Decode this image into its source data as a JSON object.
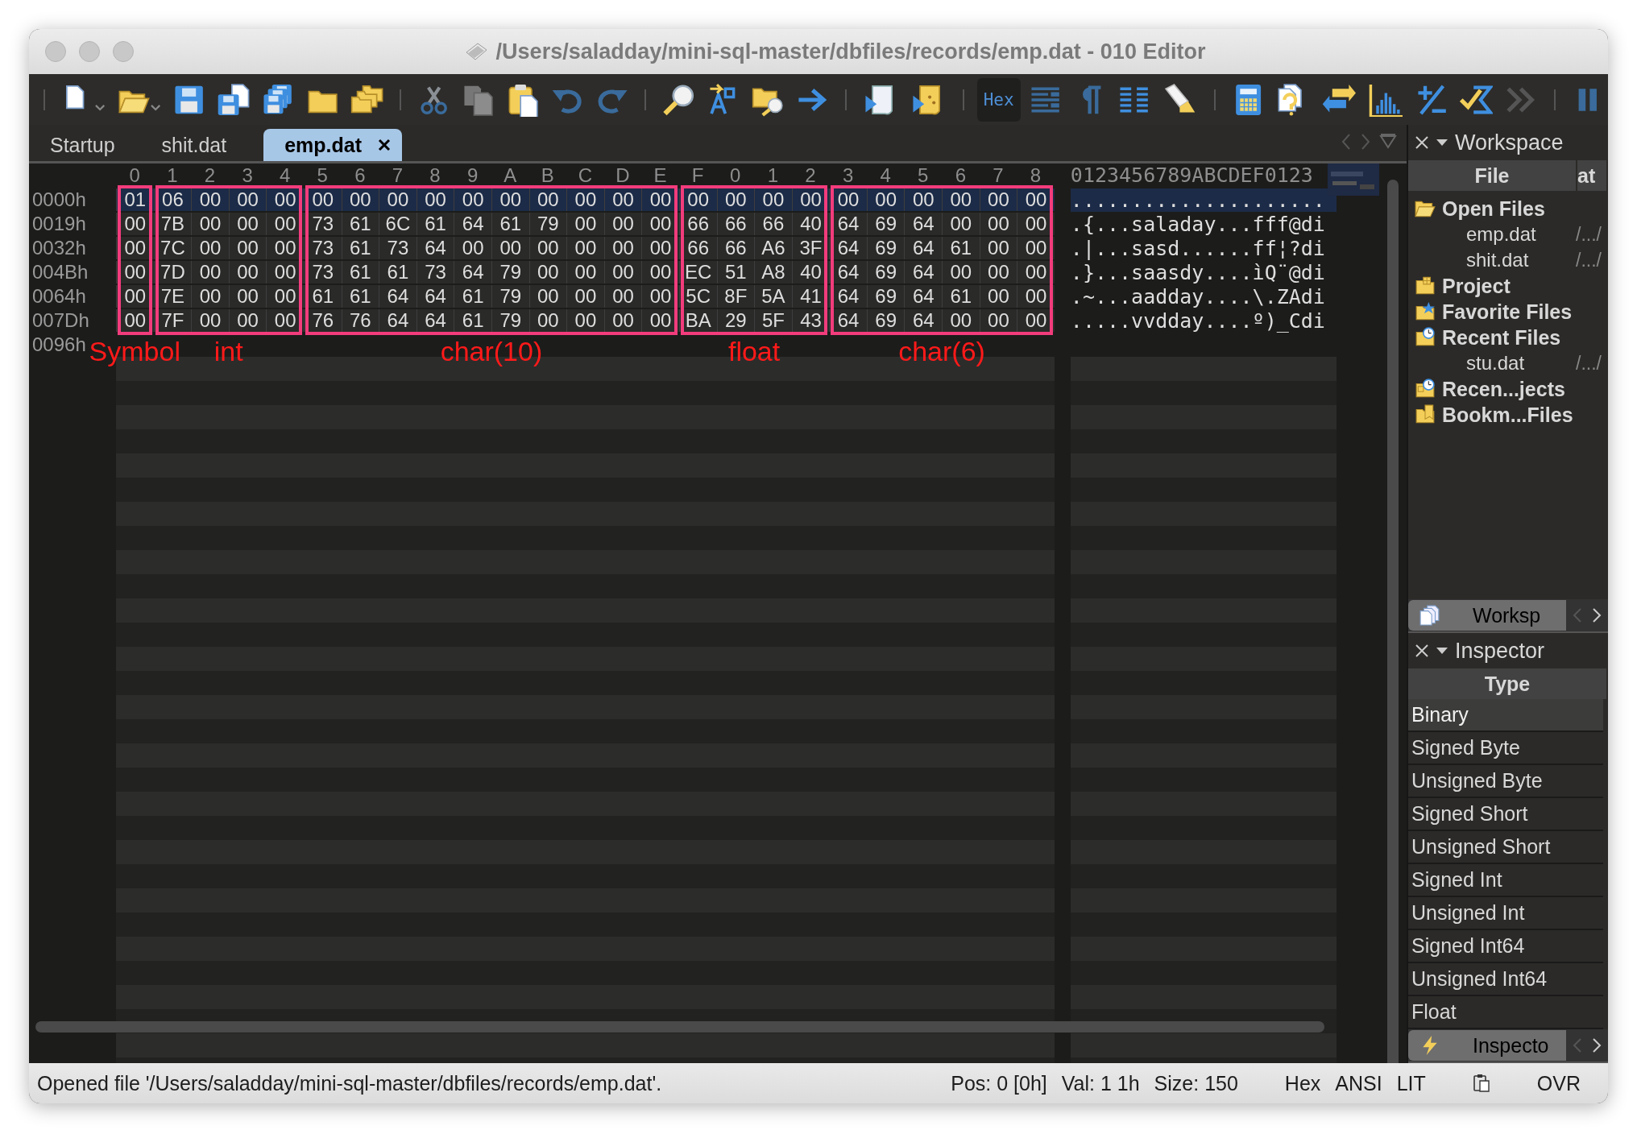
{
  "window": {
    "title": "/Users/saladday/mini-sql-master/dbfiles/records/emp.dat - 010 Editor"
  },
  "toolbar": {
    "hex_button": {
      "label": "Hex",
      "selected": true
    }
  },
  "tabs": [
    {
      "label": "Startup",
      "selected": false,
      "closable": false
    },
    {
      "label": "shit.dat",
      "selected": false,
      "closable": false
    },
    {
      "label": "emp.dat",
      "selected": true,
      "closable": true
    }
  ],
  "hex_view": {
    "ascii_header": "0123456789ABCDEF0123",
    "rows": [
      {
        "offset": "0000h",
        "selected": true,
        "bytes": [
          "01",
          "06",
          "00",
          "00",
          "00",
          "00",
          "00",
          "00",
          "00",
          "00",
          "00",
          "00",
          "00",
          "00",
          "00",
          "00",
          "00",
          "00",
          "00",
          "00",
          "00",
          "00",
          "00",
          "00",
          "00"
        ],
        "ascii": "....................."
      },
      {
        "offset": "0019h",
        "selected": false,
        "bytes": [
          "00",
          "7B",
          "00",
          "00",
          "00",
          "73",
          "61",
          "6C",
          "61",
          "64",
          "61",
          "79",
          "00",
          "00",
          "00",
          "66",
          "66",
          "66",
          "40",
          "64",
          "69",
          "64",
          "00",
          "00",
          "00"
        ],
        "ascii": ".{...saladay...fff@di"
      },
      {
        "offset": "0032h",
        "selected": false,
        "bytes": [
          "00",
          "7C",
          "00",
          "00",
          "00",
          "73",
          "61",
          "73",
          "64",
          "00",
          "00",
          "00",
          "00",
          "00",
          "00",
          "66",
          "66",
          "A6",
          "3F",
          "64",
          "69",
          "64",
          "61",
          "00",
          "00"
        ],
        "ascii": ".|...sasd......ff¦?di"
      },
      {
        "offset": "004Bh",
        "selected": false,
        "bytes": [
          "00",
          "7D",
          "00",
          "00",
          "00",
          "73",
          "61",
          "61",
          "73",
          "64",
          "79",
          "00",
          "00",
          "00",
          "00",
          "EC",
          "51",
          "A8",
          "40",
          "64",
          "69",
          "64",
          "00",
          "00",
          "00"
        ],
        "ascii": ".}...saasdy....ìQ¨@di"
      },
      {
        "offset": "0064h",
        "selected": false,
        "bytes": [
          "00",
          "7E",
          "00",
          "00",
          "00",
          "61",
          "61",
          "64",
          "64",
          "61",
          "79",
          "00",
          "00",
          "00",
          "00",
          "5C",
          "8F",
          "5A",
          "41",
          "64",
          "69",
          "64",
          "61",
          "00",
          "00"
        ],
        "ascii": ".~...aadday....\\.ZAdi"
      },
      {
        "offset": "007Dh",
        "selected": false,
        "bytes": [
          "00",
          "7F",
          "00",
          "00",
          "00",
          "76",
          "76",
          "64",
          "64",
          "61",
          "79",
          "00",
          "00",
          "00",
          "00",
          "BA",
          "29",
          "5F",
          "43",
          "64",
          "69",
          "64",
          "00",
          "00",
          "00"
        ],
        "ascii": ".....vvdday....º)_Cdi"
      },
      {
        "offset": "0096h",
        "selected": false
      }
    ],
    "annotations": [
      {
        "label": "Symbol",
        "columns": [
          "0"
        ]
      },
      {
        "label": "int",
        "columns": [
          "1",
          "2",
          "3",
          "4"
        ]
      },
      {
        "label": "char(10)",
        "columns": [
          "5",
          "6",
          "7",
          "8",
          "9",
          "A",
          "B",
          "C",
          "D",
          "E"
        ]
      },
      {
        "label": "float",
        "columns": [
          "F",
          "0",
          "1",
          "2"
        ]
      },
      {
        "label": "char(6)",
        "columns": [
          "3",
          "4",
          "5",
          "6",
          "7",
          "8"
        ]
      }
    ]
  },
  "workspace": {
    "title": "Workspace",
    "columns": [
      "File",
      "at"
    ],
    "items": [
      {
        "kind": "open",
        "label": "Open Files",
        "children": [
          {
            "name": "emp.dat",
            "path": "/.../"
          },
          {
            "name": "shit.dat",
            "path": "/.../"
          }
        ]
      },
      {
        "kind": "project",
        "label": "Project"
      },
      {
        "kind": "favorite",
        "label": "Favorite Files"
      },
      {
        "kind": "recent",
        "label": "Recent Files",
        "children": [
          {
            "name": "stu.dat",
            "path": "/.../"
          }
        ]
      },
      {
        "kind": "recentprojects",
        "label": "Recen...jects"
      },
      {
        "kind": "bookmarks",
        "label": "Bookm...Files"
      }
    ],
    "tab": "Worksp"
  },
  "inspector": {
    "title": "Inspector",
    "column": "Type",
    "tab": "Inspecto",
    "rows": [
      {
        "label": "Binary",
        "selected": true
      },
      {
        "label": "Signed Byte",
        "selected": false
      },
      {
        "label": "Unsigned Byte",
        "selected": false
      },
      {
        "label": "Signed Short",
        "selected": false
      },
      {
        "label": "Unsigned Short",
        "selected": false
      },
      {
        "label": "Signed Int",
        "selected": false
      },
      {
        "label": "Unsigned Int",
        "selected": false
      },
      {
        "label": "Signed Int64",
        "selected": false
      },
      {
        "label": "Unsigned Int64",
        "selected": false
      },
      {
        "label": "Float",
        "selected": false
      }
    ]
  },
  "status_bar": {
    "message": "Opened file '/Users/saladday/mini-sql-master/dbfiles/records/emp.dat'.",
    "position": "Pos: 0 [0h]",
    "value": "Val: 1 1h",
    "size": "Size: 150",
    "mode": "Hex",
    "charset": "ANSI",
    "endian": "LIT",
    "insert_mode": "OVR"
  }
}
